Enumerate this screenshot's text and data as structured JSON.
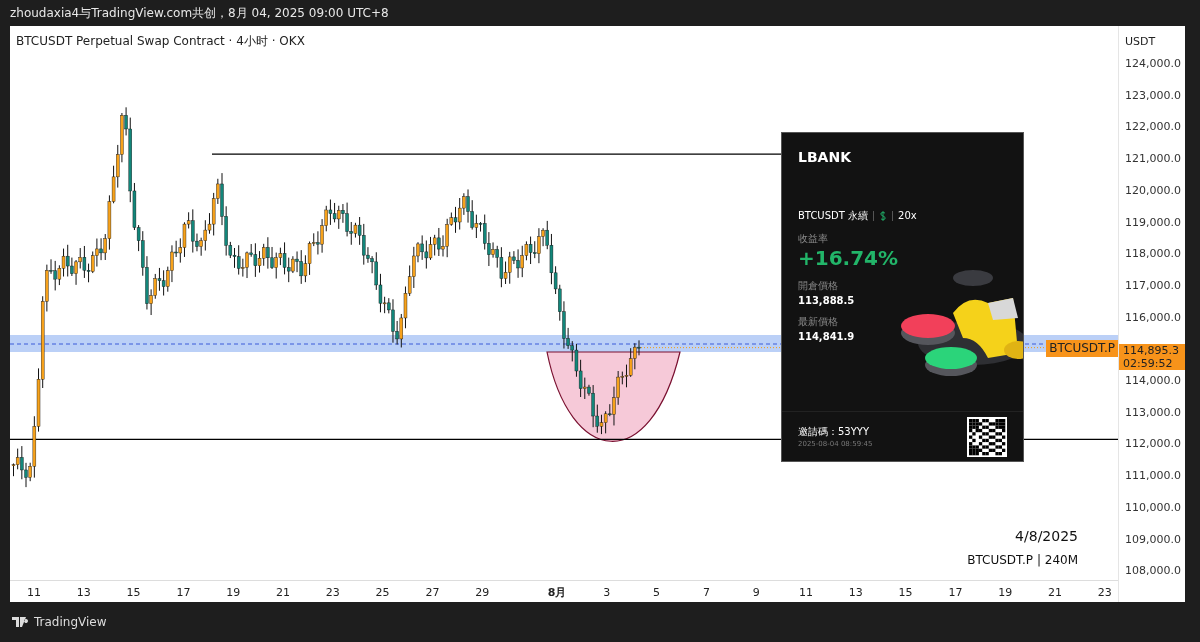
{
  "header": {
    "title": "zhoudaxia4与TradingView.com共创，8月 04, 2025 09:00 UTC+8"
  },
  "chart": {
    "title": "BTCUSDT Perpetual Swap Contract · 4小时 · OKX",
    "price_axis": {
      "unit": "USDT",
      "labels": [
        "124,000.0",
        "123,000.0",
        "122,000.0",
        "121,000.0",
        "120,000.0",
        "119,000.0",
        "118,000.0",
        "117,000.0",
        "116,000.0",
        "114,000.0",
        "113,000.0",
        "112,000.0",
        "111,000.0",
        "110,000.0",
        "109,000.0",
        "108,000.0"
      ]
    },
    "time_axis": [
      {
        "text": "11",
        "bold": false
      },
      {
        "text": "13",
        "bold": false
      },
      {
        "text": "15",
        "bold": false
      },
      {
        "text": "17",
        "bold": false
      },
      {
        "text": "19",
        "bold": false
      },
      {
        "text": "21",
        "bold": false
      },
      {
        "text": "23",
        "bold": false
      },
      {
        "text": "25",
        "bold": false
      },
      {
        "text": "27",
        "bold": false
      },
      {
        "text": "29",
        "bold": false
      },
      {
        "text": "8月",
        "bold": true
      },
      {
        "text": "3",
        "bold": false
      },
      {
        "text": "5",
        "bold": false
      },
      {
        "text": "7",
        "bold": false
      },
      {
        "text": "9",
        "bold": false
      },
      {
        "text": "11",
        "bold": false
      },
      {
        "text": "13",
        "bold": false
      },
      {
        "text": "15",
        "bold": false
      },
      {
        "text": "17",
        "bold": false
      },
      {
        "text": "19",
        "bold": false
      },
      {
        "text": "21",
        "bold": false
      },
      {
        "text": "23",
        "bold": false
      }
    ],
    "symbol_tag": "BTCUSDT.P",
    "last_price": "114,895.3",
    "countdown": "02:59:52",
    "date_note": "4/8/2025",
    "symbol_note": "BTCUSDT.P | 240M"
  },
  "promo_card": {
    "logo": "LBANK",
    "pair": "BTCUSDT 永續",
    "leverage": "20x",
    "return_label": "收益率",
    "return_value": "+16.74%",
    "open_label": "開倉價格",
    "open_value": "113,888.5",
    "last_label": "最新價格",
    "last_value": "114,841.9",
    "invite": "邀請碼：53YYY",
    "timestamp": "2025-08-04 08:59:45"
  },
  "footer": {
    "brand": "TradingView"
  }
}
